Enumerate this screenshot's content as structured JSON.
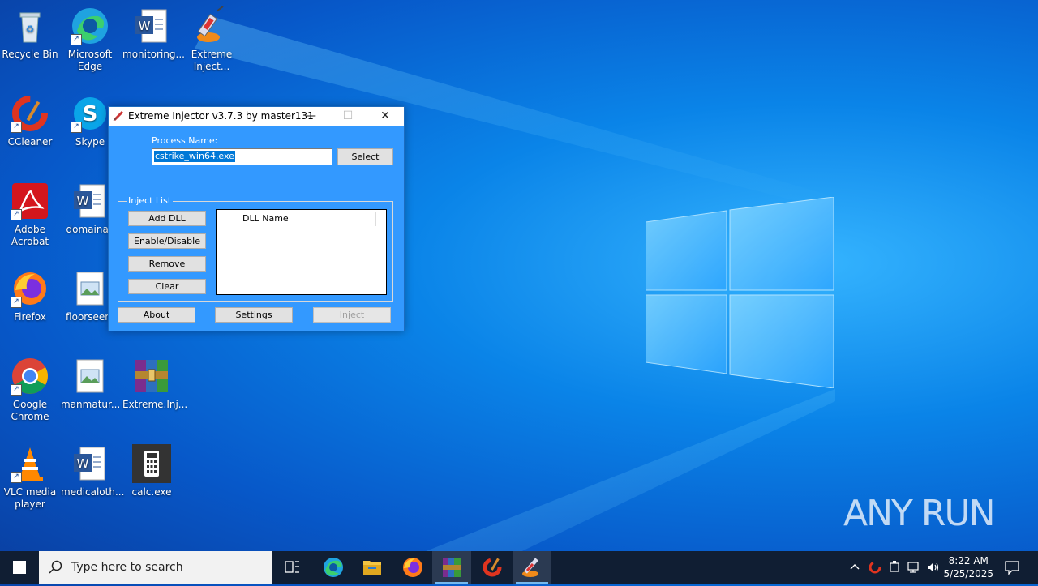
{
  "desktop": {
    "icons": [
      {
        "label": "Recycle Bin"
      },
      {
        "label": "Microsoft Edge"
      },
      {
        "label": "monitoring..."
      },
      {
        "label": "Extreme Inject..."
      },
      {
        "label": "CCleaner"
      },
      {
        "label": "Skype"
      },
      {
        "label": "Adobe Acrobat"
      },
      {
        "label": "domainac"
      },
      {
        "label": "Firefox"
      },
      {
        "label": "floorseem"
      },
      {
        "label": "Google Chrome"
      },
      {
        "label": "manmatur..."
      },
      {
        "label": "Extreme.Inj..."
      },
      {
        "label": "VLC media player"
      },
      {
        "label": "medicaloth..."
      },
      {
        "label": "calc.exe"
      }
    ]
  },
  "window": {
    "title": "Extreme Injector v3.7.3 by master131",
    "process_label": "Process Name:",
    "process_value": "cstrike_win64.exe",
    "select_label": "Select",
    "group_label": "Inject List",
    "buttons": {
      "add_dll": "Add DLL",
      "enable_disable": "Enable/Disable",
      "remove": "Remove",
      "clear": "Clear",
      "about": "About",
      "settings": "Settings",
      "inject": "Inject"
    },
    "list_header": "DLL Name"
  },
  "taskbar": {
    "search_placeholder": "Type here to search",
    "time": "8:22 AM",
    "date": "5/25/2025"
  },
  "watermark": "ANY RUN",
  "colors": {
    "accent": "#0078d7",
    "client_bg": "#3399ff",
    "taskbar": "#101e33"
  }
}
